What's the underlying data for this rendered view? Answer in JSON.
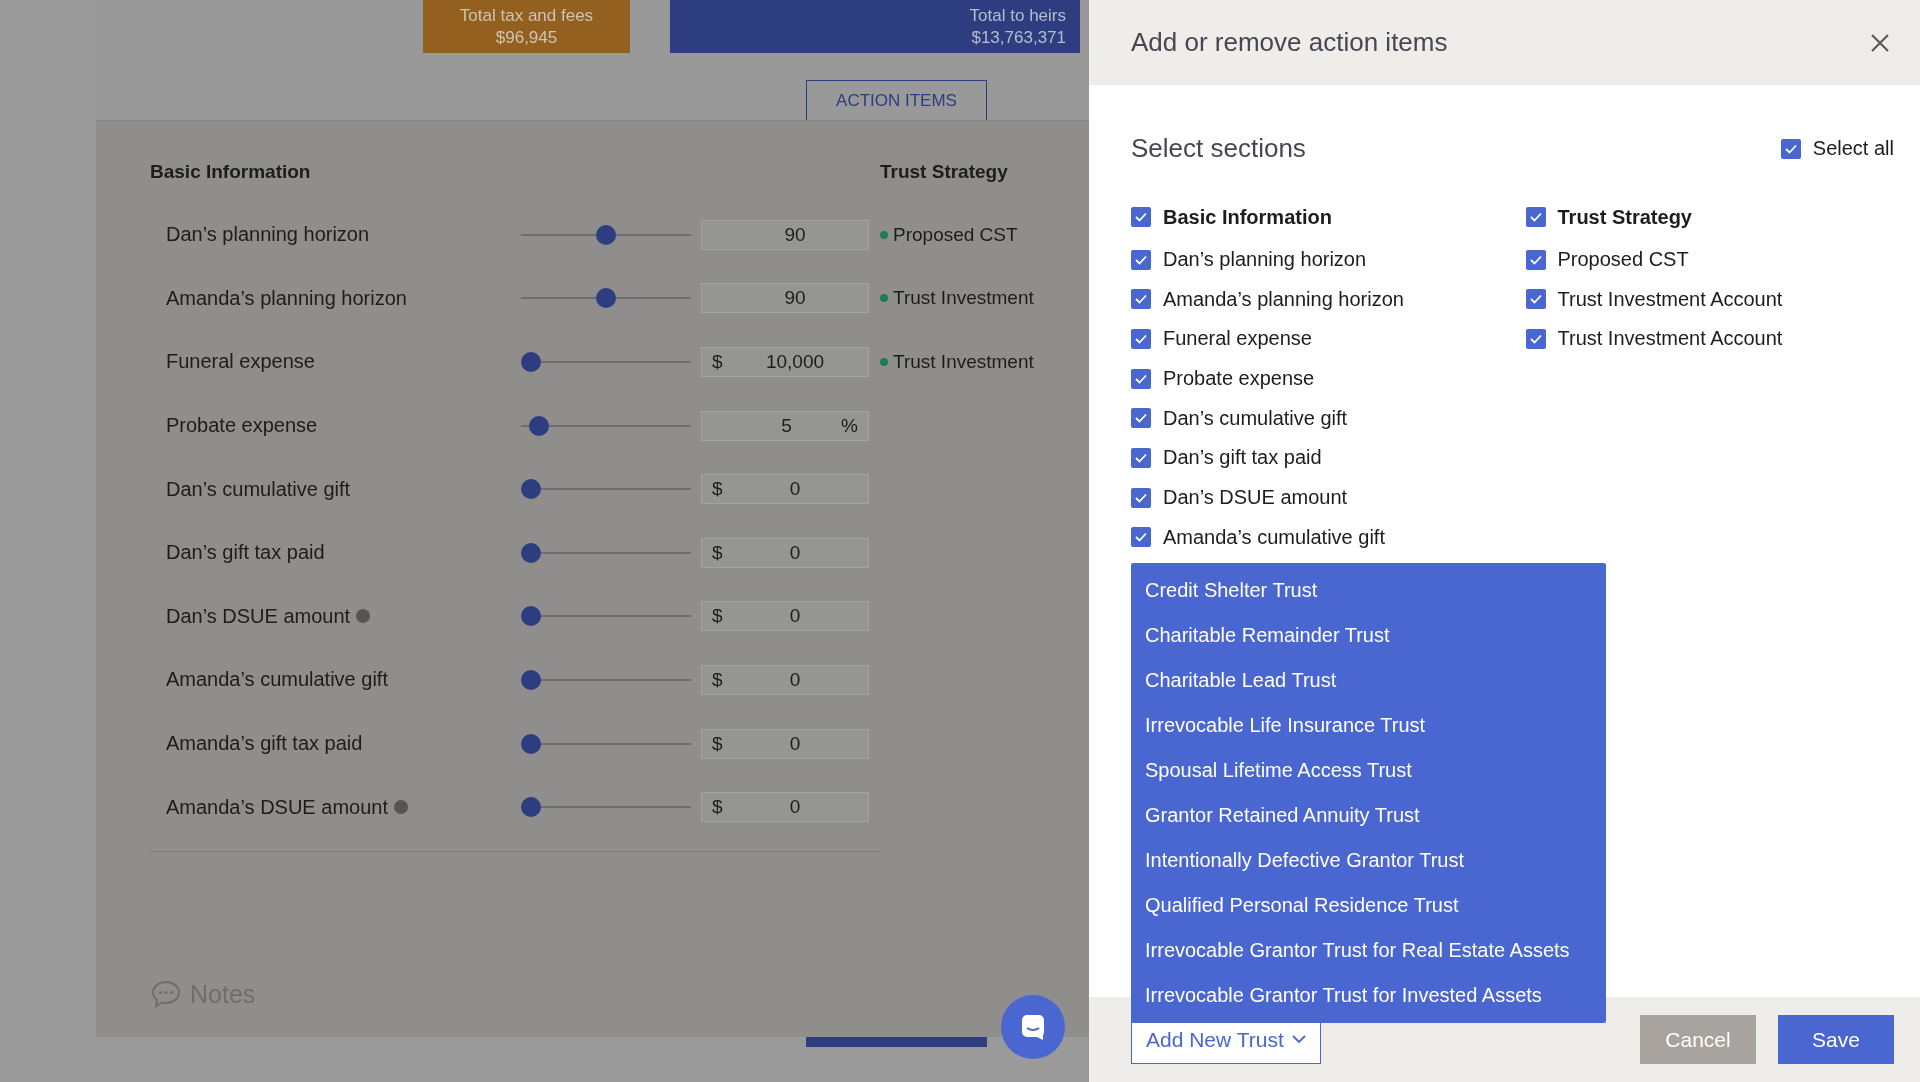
{
  "summary": [
    {
      "kind": "tax",
      "label": "Total tax and fees",
      "value": "$96,945"
    },
    {
      "kind": "heirs",
      "label": "Total to heirs",
      "value": "$13,763,371"
    }
  ],
  "action_items_button": "ACTION ITEMS",
  "basic_info": {
    "title": "Basic Information",
    "rows": [
      {
        "label": "Dan’s planning horizon",
        "level": 0.5,
        "value": "90"
      },
      {
        "label": "Amanda’s planning horizon",
        "level": 0.5,
        "value": "90"
      },
      {
        "label": "Funeral expense",
        "level": 0,
        "prefix": "$",
        "value": "10,000"
      },
      {
        "label": "Probate expense",
        "level": 0.05,
        "value": "5",
        "suffix": "%"
      },
      {
        "label": "Dan’s cumulative gift",
        "level": 0,
        "prefix": "$",
        "value": "0"
      },
      {
        "label": "Dan’s gift tax paid",
        "level": 0,
        "prefix": "$",
        "value": "0"
      },
      {
        "label": "Dan’s DSUE amount",
        "level": 0,
        "prefix": "$",
        "value": "0",
        "info": true
      },
      {
        "label": "Amanda’s cumulative gift",
        "level": 0,
        "prefix": "$",
        "value": "0"
      },
      {
        "label": "Amanda’s gift tax paid",
        "level": 0,
        "prefix": "$",
        "value": "0"
      },
      {
        "label": "Amanda’s DSUE amount",
        "level": 0,
        "prefix": "$",
        "value": "0",
        "info": true
      }
    ]
  },
  "trust_strategy": {
    "title": "Trust Strategy",
    "items": [
      {
        "label": "Proposed CST",
        "color": "#1f7a5c"
      },
      {
        "label": "Trust Investment",
        "color": "#1f7a5c"
      },
      {
        "label": "Trust Investment",
        "color": "#1f7a5c"
      }
    ]
  },
  "notes": {
    "label": "Notes"
  },
  "dialog": {
    "title": "Add or remove action items",
    "section_heading": "Select sections",
    "select_all": {
      "label": "Select all",
      "checked": true
    },
    "columns": [
      {
        "heading": {
          "label": "Basic Information",
          "checked": true
        },
        "items": [
          {
            "label": "Dan’s planning horizon",
            "checked": true
          },
          {
            "label": "Amanda’s planning horizon",
            "checked": true
          },
          {
            "label": "Funeral expense",
            "checked": true
          },
          {
            "label": "Probate expense",
            "checked": true
          },
          {
            "label": "Dan’s cumulative gift",
            "checked": true
          },
          {
            "label": "Dan’s gift tax paid",
            "checked": true
          },
          {
            "label": "Dan’s DSUE amount",
            "checked": true
          },
          {
            "label": "Amanda’s cumulative gift",
            "checked": true
          }
        ]
      },
      {
        "heading": {
          "label": "Trust Strategy",
          "checked": true
        },
        "items": [
          {
            "label": "Proposed CST",
            "checked": true
          },
          {
            "label": "Trust Investment Account",
            "checked": true
          },
          {
            "label": "Trust Investment Account",
            "checked": true
          }
        ]
      }
    ],
    "dropdown": {
      "items": [
        "Credit Shelter Trust",
        "Charitable Remainder Trust",
        "Charitable Lead Trust",
        "Irrevocable Life Insurance Trust",
        "Spousal Lifetime Access Trust",
        "Grantor Retained Annuity Trust",
        "Intentionally Defective Grantor Trust",
        "Qualified Personal Residence Trust",
        "Irrevocable Grantor Trust for Real Estate Assets",
        "Irrevocable Grantor Trust for Invested Assets"
      ]
    },
    "add_button": "Add New Trust",
    "buttons": [
      {
        "kind": "cancel",
        "label": "Cancel"
      },
      {
        "kind": "save",
        "label": "Save"
      }
    ]
  }
}
